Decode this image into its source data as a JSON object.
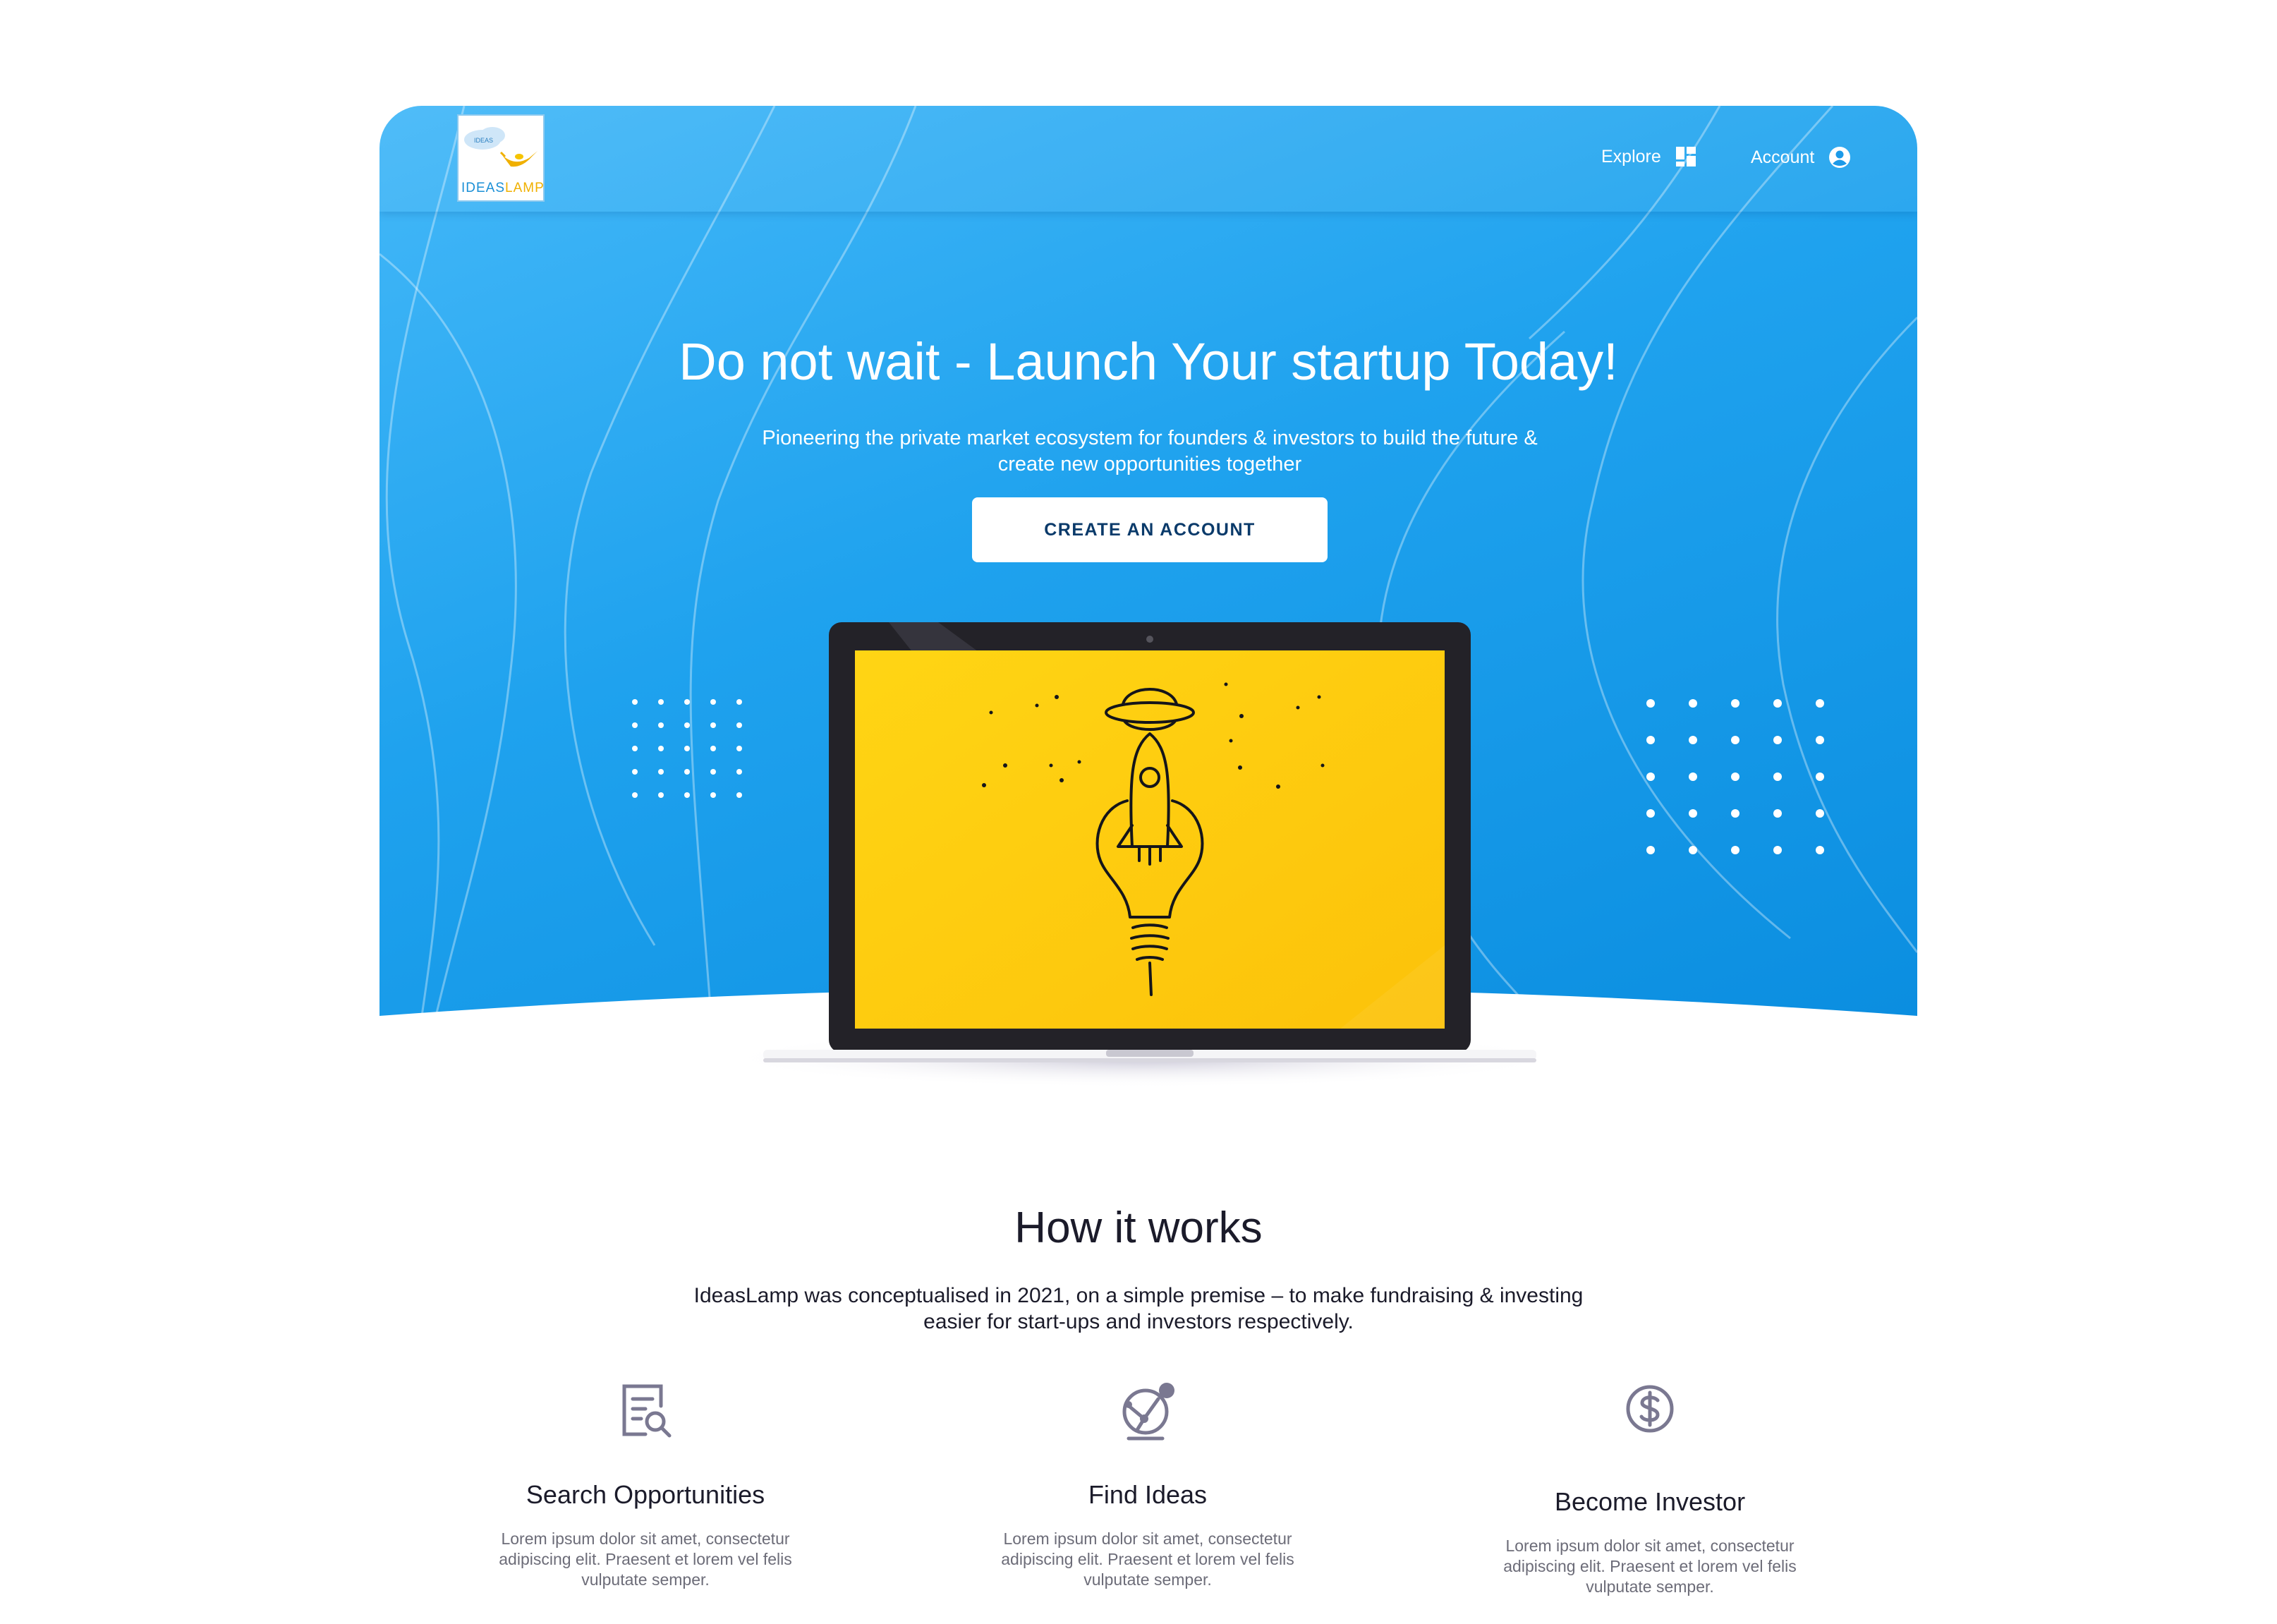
{
  "nav": {
    "logo_word_ideas": "IDEAS",
    "logo_word_lamp": "LAMP",
    "logo_cloud_text": "IDEAS",
    "explore_label": "Explore",
    "account_label": "Account"
  },
  "hero": {
    "title": "Do not wait - Launch Your startup Today!",
    "subtitle": "Pioneering the private market ecosystem for founders & investors to build the future & create new opportunities together",
    "cta_label": "CREATE AN ACCOUNT"
  },
  "how": {
    "title": "How it works",
    "subtitle": "IdeasLamp was conceptualised in 2021, on a simple premise – to make fundraising & investing easier for start-ups and investors respectively.",
    "features": [
      {
        "title": "Search Opportunities",
        "desc": "Lorem ipsum dolor sit amet, consectetur adipiscing elit. Praesent et lorem vel felis vulputate semper.",
        "icon": "document-search-icon"
      },
      {
        "title": "Find Ideas",
        "desc": "Lorem ipsum dolor sit amet, consectetur adipiscing elit. Praesent et lorem vel felis vulputate semper.",
        "icon": "globe-network-icon"
      },
      {
        "title": "Become Investor",
        "desc": "Lorem ipsum dolor sit amet, consectetur adipiscing elit. Praesent et lorem vel felis vulputate semper.",
        "icon": "dollar-coin-icon"
      }
    ]
  },
  "colors": {
    "hero_blue": "#1fa2ee",
    "screen_yellow": "#fcc70a",
    "cta_text": "#0a3a6a",
    "icon_gray": "#7a7891"
  }
}
